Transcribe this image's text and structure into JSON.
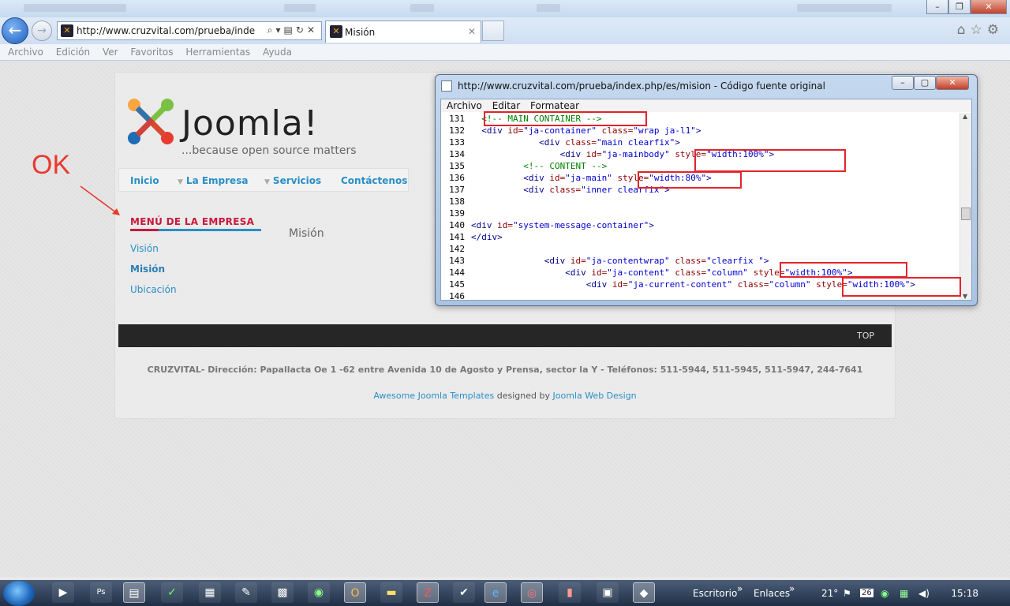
{
  "browser": {
    "url": "http://www.cruzvital.com/prueba/index.ph",
    "tab_title": "Misión",
    "menu": [
      "Archivo",
      "Edición",
      "Ver",
      "Favoritos",
      "Herramientas",
      "Ayuda"
    ]
  },
  "site": {
    "logo_word": "Joomla!",
    "logo_tagline": "...because open source matters",
    "nav": [
      "Inicio",
      "La Empresa",
      "Servicios",
      "Contáctenos"
    ],
    "side_menu_title": "MENÚ DE LA EMPRESA",
    "side_menu_items": [
      "Visión",
      "Misión",
      "Ubicación"
    ],
    "content_title": "Misión",
    "footer_top": "TOP",
    "footer_address": "CRUZVITAL- Dirección: Papallacta Oe 1 -62 entre Avenida 10 de Agosto y Prensa, sector la Y -  Teléfonos: 511-5944, 511-5945, 511-5947, 244-7641",
    "credit_link1": "Awesome Joomla Templates",
    "credit_mid": " designed by ",
    "credit_link2": "Joomla Web Design"
  },
  "annotation": {
    "ok_label": "OK"
  },
  "source_window": {
    "title": "http://www.cruzvital.com/prueba/index.php/es/mision - Código fuente original",
    "menu": [
      "Archivo",
      "Editar",
      "Formatear"
    ],
    "lines": [
      {
        "n": "131",
        "html": "  <span class=\"cmt\">&lt;!-- MAIN CONTAINER --&gt;</span>"
      },
      {
        "n": "132",
        "html": "  <span class=\"tag\">&lt;div</span> <span class=\"attr\">id=</span><span class=\"str\">\"ja-container\"</span> <span class=\"attr\">class=</span><span class=\"str\">\"wrap ja-l1\"</span><span class=\"tag\">&gt;</span>"
      },
      {
        "n": "133",
        "html": "             <span class=\"tag\">&lt;div</span> <span class=\"attr\">class=</span><span class=\"str\">\"main clearfix\"</span><span class=\"tag\">&gt;</span>"
      },
      {
        "n": "134",
        "html": "                 <span class=\"tag\">&lt;div</span> <span class=\"attr\">id=</span><span class=\"str\">\"ja-mainbody\"</span> <span class=\"attr\">style=</span><span class=\"str\">\"width:100%\"</span><span class=\"tag\">&gt;</span>"
      },
      {
        "n": "135",
        "html": "          <span class=\"cmt\">&lt;!-- CONTENT --&gt;</span>"
      },
      {
        "n": "136",
        "html": "          <span class=\"tag\">&lt;div</span> <span class=\"attr\">id=</span><span class=\"str\">\"ja-main\"</span> <span class=\"attr\">style=</span><span class=\"str\">\"width:80%\"</span><span class=\"tag\">&gt;</span>"
      },
      {
        "n": "137",
        "html": "          <span class=\"tag\">&lt;div</span> <span class=\"attr\">class=</span><span class=\"str\">\"inner clearfix\"</span><span class=\"tag\">&gt;</span>"
      },
      {
        "n": "138",
        "html": ""
      },
      {
        "n": "139",
        "html": ""
      },
      {
        "n": "140",
        "html": "<span class=\"tag\">&lt;div</span> <span class=\"attr\">id=</span><span class=\"str\">\"system-message-container\"</span><span class=\"tag\">&gt;</span>"
      },
      {
        "n": "141",
        "html": "<span class=\"tag\">&lt;/div&gt;</span>"
      },
      {
        "n": "142",
        "html": ""
      },
      {
        "n": "143",
        "html": "              <span class=\"tag\">&lt;div</span> <span class=\"attr\">id=</span><span class=\"str\">\"ja-contentwrap\"</span> <span class=\"attr\">class=</span><span class=\"str\">\"clearfix \"</span><span class=\"tag\">&gt;</span>"
      },
      {
        "n": "144",
        "html": "                  <span class=\"tag\">&lt;div</span> <span class=\"attr\">id=</span><span class=\"str\">\"ja-content\"</span> <span class=\"attr\">class=</span><span class=\"str\">\"column\"</span> <span class=\"attr\">style=</span><span class=\"str\">\"width:100%\"</span><span class=\"tag\">&gt;</span>"
      },
      {
        "n": "145",
        "html": "                      <span class=\"tag\">&lt;div</span> <span class=\"attr\">id=</span><span class=\"str\">\"ja-current-content\"</span> <span class=\"attr\">class=</span><span class=\"str\">\"column\"</span> <span class=\"attr\">style=</span><span class=\"str\">\"width:100%\"</span><span class=\"tag\">&gt;</span>"
      },
      {
        "n": "146",
        "html": ""
      }
    ]
  },
  "taskbar": {
    "toolbar_escritorio": "Escritorio",
    "toolbar_enlaces": "Enlaces",
    "temperature": "21°",
    "calendar_day": "26",
    "clock": "15:18"
  },
  "colors": {
    "accent_blue": "#2a8fc6",
    "accent_red": "#c8193c",
    "highlight_red": "#e3242b"
  }
}
